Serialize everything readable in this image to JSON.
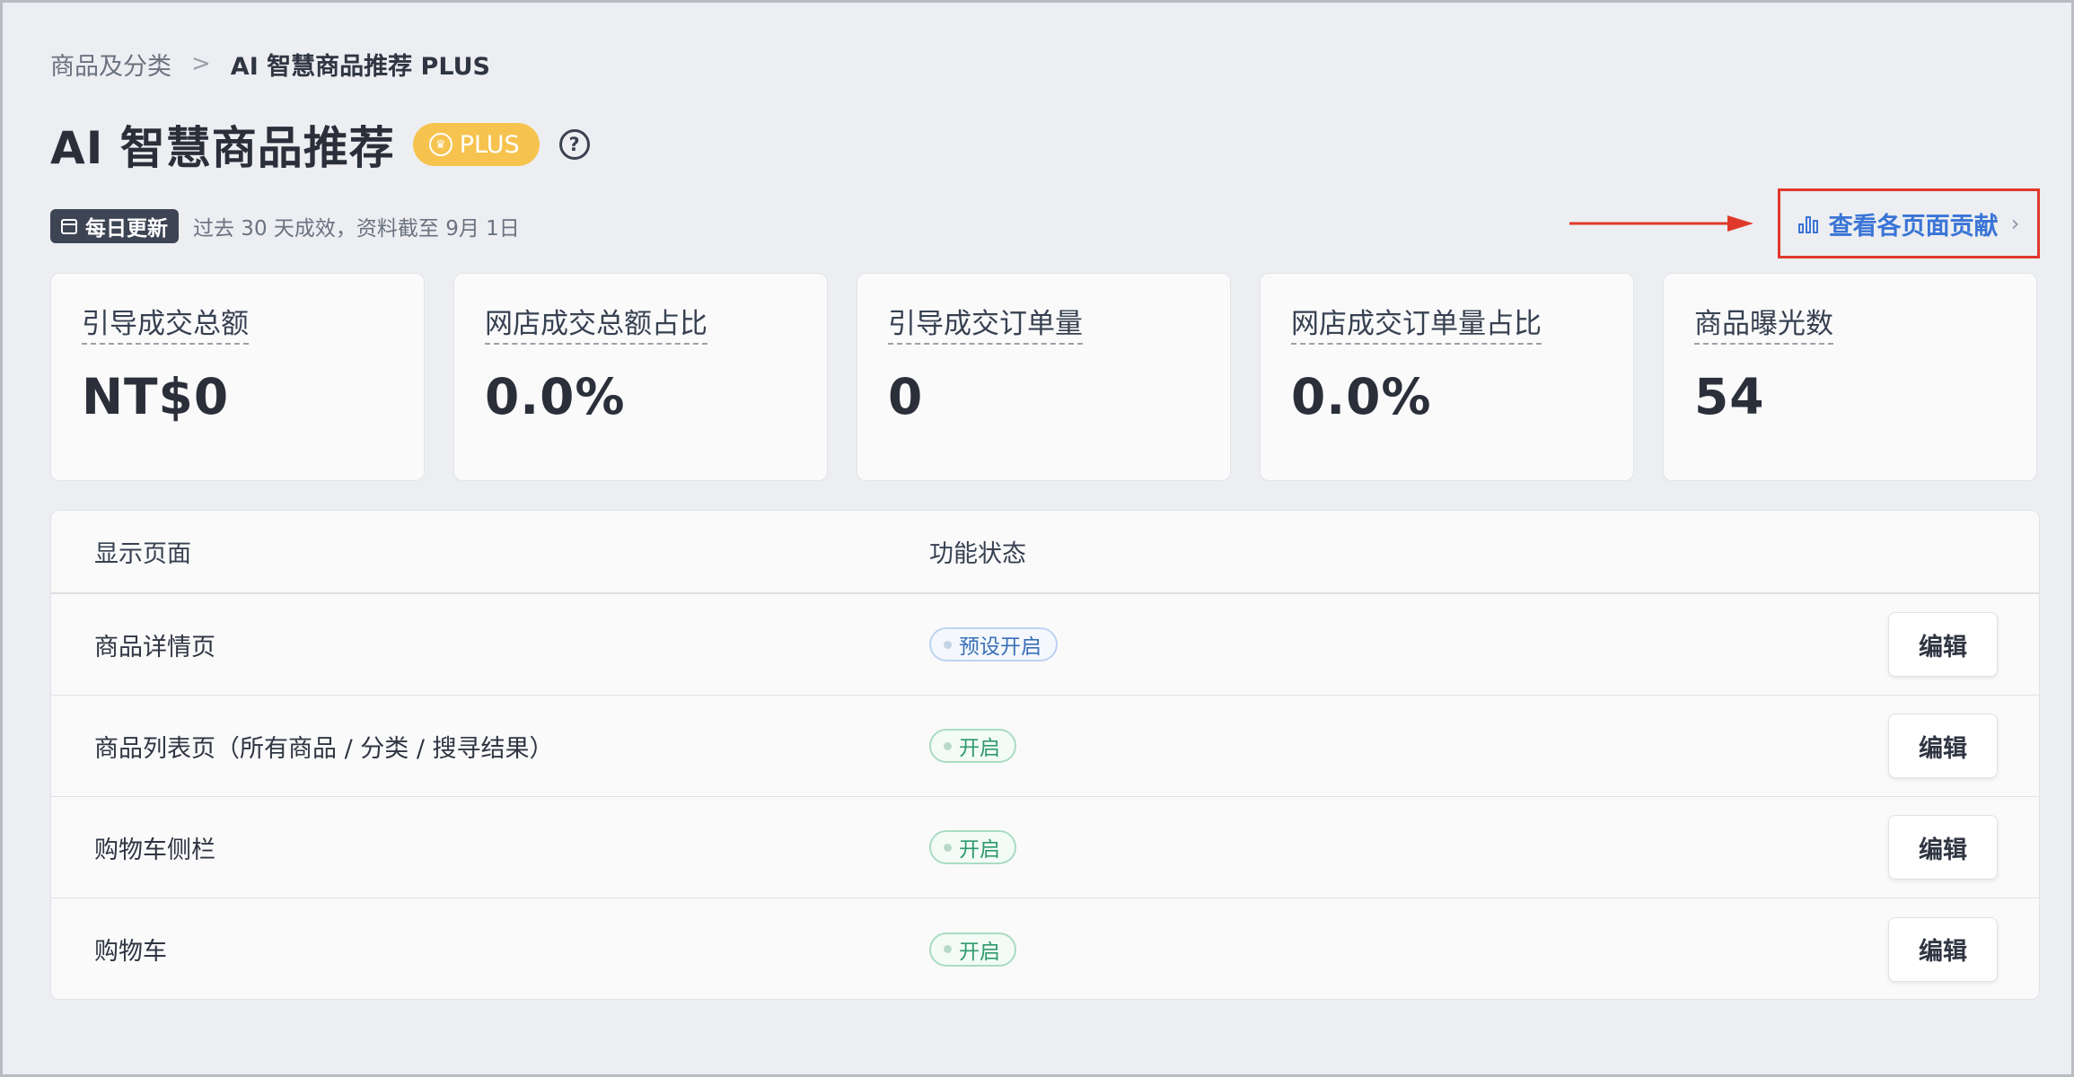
{
  "breadcrumb": {
    "parent": "商品及分类",
    "separator": ">",
    "current": "AI 智慧商品推荐 PLUS"
  },
  "header": {
    "title": "AI 智慧商品推荐",
    "badge": "PLUS",
    "help_icon": "question-circle-icon"
  },
  "update": {
    "tag": "每日更新",
    "description": "过去 30 天成效，资料截至 9月 1日"
  },
  "contribution_link": {
    "label": "查看各页面贡献",
    "icon": "bar-chart-icon",
    "highlight_color": "#e0392b"
  },
  "metrics": [
    {
      "label": "引导成交总额",
      "value": "NT$0"
    },
    {
      "label": "网店成交总额占比",
      "value": "0.0%"
    },
    {
      "label": "引导成交订单量",
      "value": "0"
    },
    {
      "label": "网店成交订单量占比",
      "value": "0.0%"
    },
    {
      "label": "商品曝光数",
      "value": "54"
    }
  ],
  "table": {
    "headers": {
      "page": "显示页面",
      "status": "功能状态"
    },
    "rows": [
      {
        "page": "商品详情页",
        "status": "预设开启",
        "action": "编辑"
      },
      {
        "page": "商品列表页（所有商品 / 分类 / 搜寻结果）",
        "status": "开启",
        "action": "编辑"
      },
      {
        "page": "购物车侧栏",
        "status": "开启",
        "action": "编辑"
      },
      {
        "page": "购物车",
        "status": "开启",
        "action": "编辑"
      }
    ]
  },
  "colors": {
    "accent_link": "#3a74d6",
    "plus_badge": "#f6c34f",
    "status_default": "#3a6fb8",
    "status_on": "#2f9a6a"
  }
}
